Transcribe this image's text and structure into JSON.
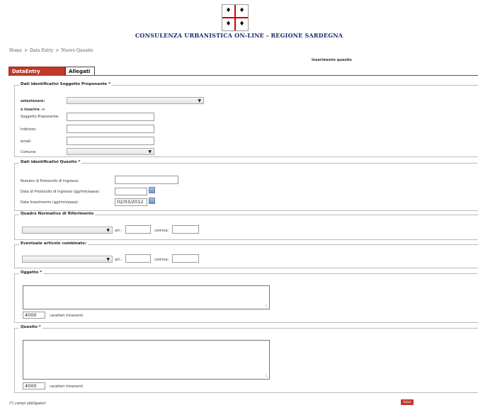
{
  "header": {
    "site_title": "CONSULENZA URBANISTICA ON-LINE - REGIONE SARDEGNA",
    "logo_name": "sardinia-flag-logo"
  },
  "breadcrumb": {
    "items": [
      "Home",
      "Data Entry",
      "Nuovo Quesito"
    ],
    "separator": ">"
  },
  "page_title": "Inserimento quesito",
  "tabs": [
    {
      "label": "DataEntry Pratica",
      "active": true
    },
    {
      "label": "Allegati",
      "active": false
    }
  ],
  "sections": {
    "soggetto": {
      "legend": "Dati identificativi Soggetto Proponente *",
      "select_label": "selezionare:",
      "or_insert_label": "o inserire ->",
      "soggetto_label": "Soggetto Proponente:",
      "indirizzo_label": "Indirizzo:",
      "email_label": "email:",
      "comune_label": "Comune:"
    },
    "quesito_dati": {
      "legend": "Dati identificativi Quesito *",
      "protocollo_label": "Numero di Protocollo di Ingresso:",
      "data_protocollo_label": "Data di Protocollo di Ingresso (gg/mm/aaaa):",
      "data_inserimento_label": "Data Inserimento (gg/mm/aaaa):",
      "data_inserimento_value": "02/03/2012"
    },
    "quadro": {
      "legend": "Quadro Normativo di Riferimento",
      "art_label": "art.:",
      "comma_label": "comma:"
    },
    "eventuale": {
      "legend": "Eventuale articolo combinato:",
      "art_label": "art.:",
      "comma_label": "comma:"
    },
    "oggetto": {
      "legend": "Oggetto *",
      "count_value": "4000",
      "count_label": "caratteri rimanenti"
    },
    "quesito": {
      "legend": "Quesito *",
      "count_value": "4000",
      "count_label": "caratteri rimanenti"
    }
  },
  "footer": {
    "note": "(*) campi obbligatori",
    "save_label": "Salva"
  },
  "colors": {
    "accent": "#c0392b",
    "title_blue": "#1a2a6c"
  }
}
